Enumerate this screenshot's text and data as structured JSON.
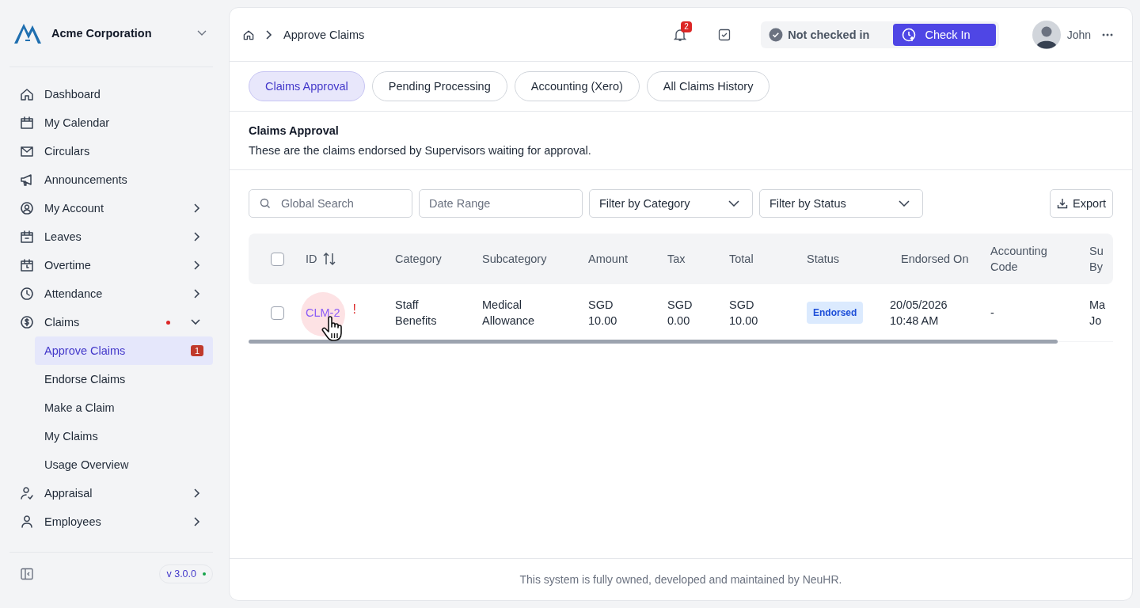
{
  "sidebar": {
    "company": "Acme Corporation",
    "items": [
      {
        "label": "Dashboard",
        "has_submenu": false,
        "dot": false
      },
      {
        "label": "My Calendar",
        "has_submenu": false,
        "dot": false
      },
      {
        "label": "Circulars",
        "has_submenu": false,
        "dot": false
      },
      {
        "label": "Announcements",
        "has_submenu": false,
        "dot": false
      },
      {
        "label": "My Account",
        "has_submenu": true,
        "expanded": false,
        "dot": false
      },
      {
        "label": "Leaves",
        "has_submenu": true,
        "expanded": false,
        "dot": false
      },
      {
        "label": "Overtime",
        "has_submenu": true,
        "expanded": false,
        "dot": false
      },
      {
        "label": "Attendance",
        "has_submenu": true,
        "expanded": false,
        "dot": false
      },
      {
        "label": "Claims",
        "has_submenu": true,
        "expanded": true,
        "dot": true,
        "children": [
          {
            "label": "Approve Claims",
            "selected": true,
            "badge": "1"
          },
          {
            "label": "Endorse Claims",
            "selected": false
          },
          {
            "label": "Make a Claim",
            "selected": false
          },
          {
            "label": "My Claims",
            "selected": false
          },
          {
            "label": "Usage Overview",
            "selected": false
          }
        ]
      },
      {
        "label": "Appraisal",
        "has_submenu": true,
        "expanded": false,
        "dot": false
      },
      {
        "label": "Employees",
        "has_submenu": true,
        "expanded": false,
        "dot": false
      }
    ],
    "version": "v 3.0.0"
  },
  "header": {
    "breadcrumb": "Approve Claims",
    "notifications": "2",
    "check_status": "Not checked in",
    "check_in_button": "Check In",
    "user": "John"
  },
  "tabs": [
    {
      "label": "Claims Approval",
      "selected": true
    },
    {
      "label": "Pending Processing",
      "selected": false
    },
    {
      "label": "Accounting (Xero)",
      "selected": false
    },
    {
      "label": "All Claims History",
      "selected": false
    }
  ],
  "section": {
    "title": "Claims Approval",
    "description": "These are the claims endorsed by Supervisors waiting for approval."
  },
  "filters": {
    "search_placeholder": "Global Search",
    "date_placeholder": "Date Range",
    "category": "Filter by Category",
    "status": "Filter by Status",
    "export": "Export"
  },
  "table": {
    "columns": [
      "ID",
      "Category",
      "Subcategory",
      "Amount",
      "Tax",
      "Total",
      "Status",
      "Endorsed On",
      "Accounting Code",
      "Su By"
    ],
    "select_all_checked": false,
    "rows": [
      {
        "checked": false,
        "flag": "!",
        "cells": [
          "CLM-2",
          "Staff Benefits",
          "Medical Allowance",
          "SGD 10.00",
          "SGD 0.00",
          "SGD 10.00",
          "Endorsed",
          "20/05/2026 10:48 AM",
          "-",
          "Ma Jo"
        ]
      }
    ]
  },
  "footer": "This system is fully owned, developed and maintained by NeuHR."
}
